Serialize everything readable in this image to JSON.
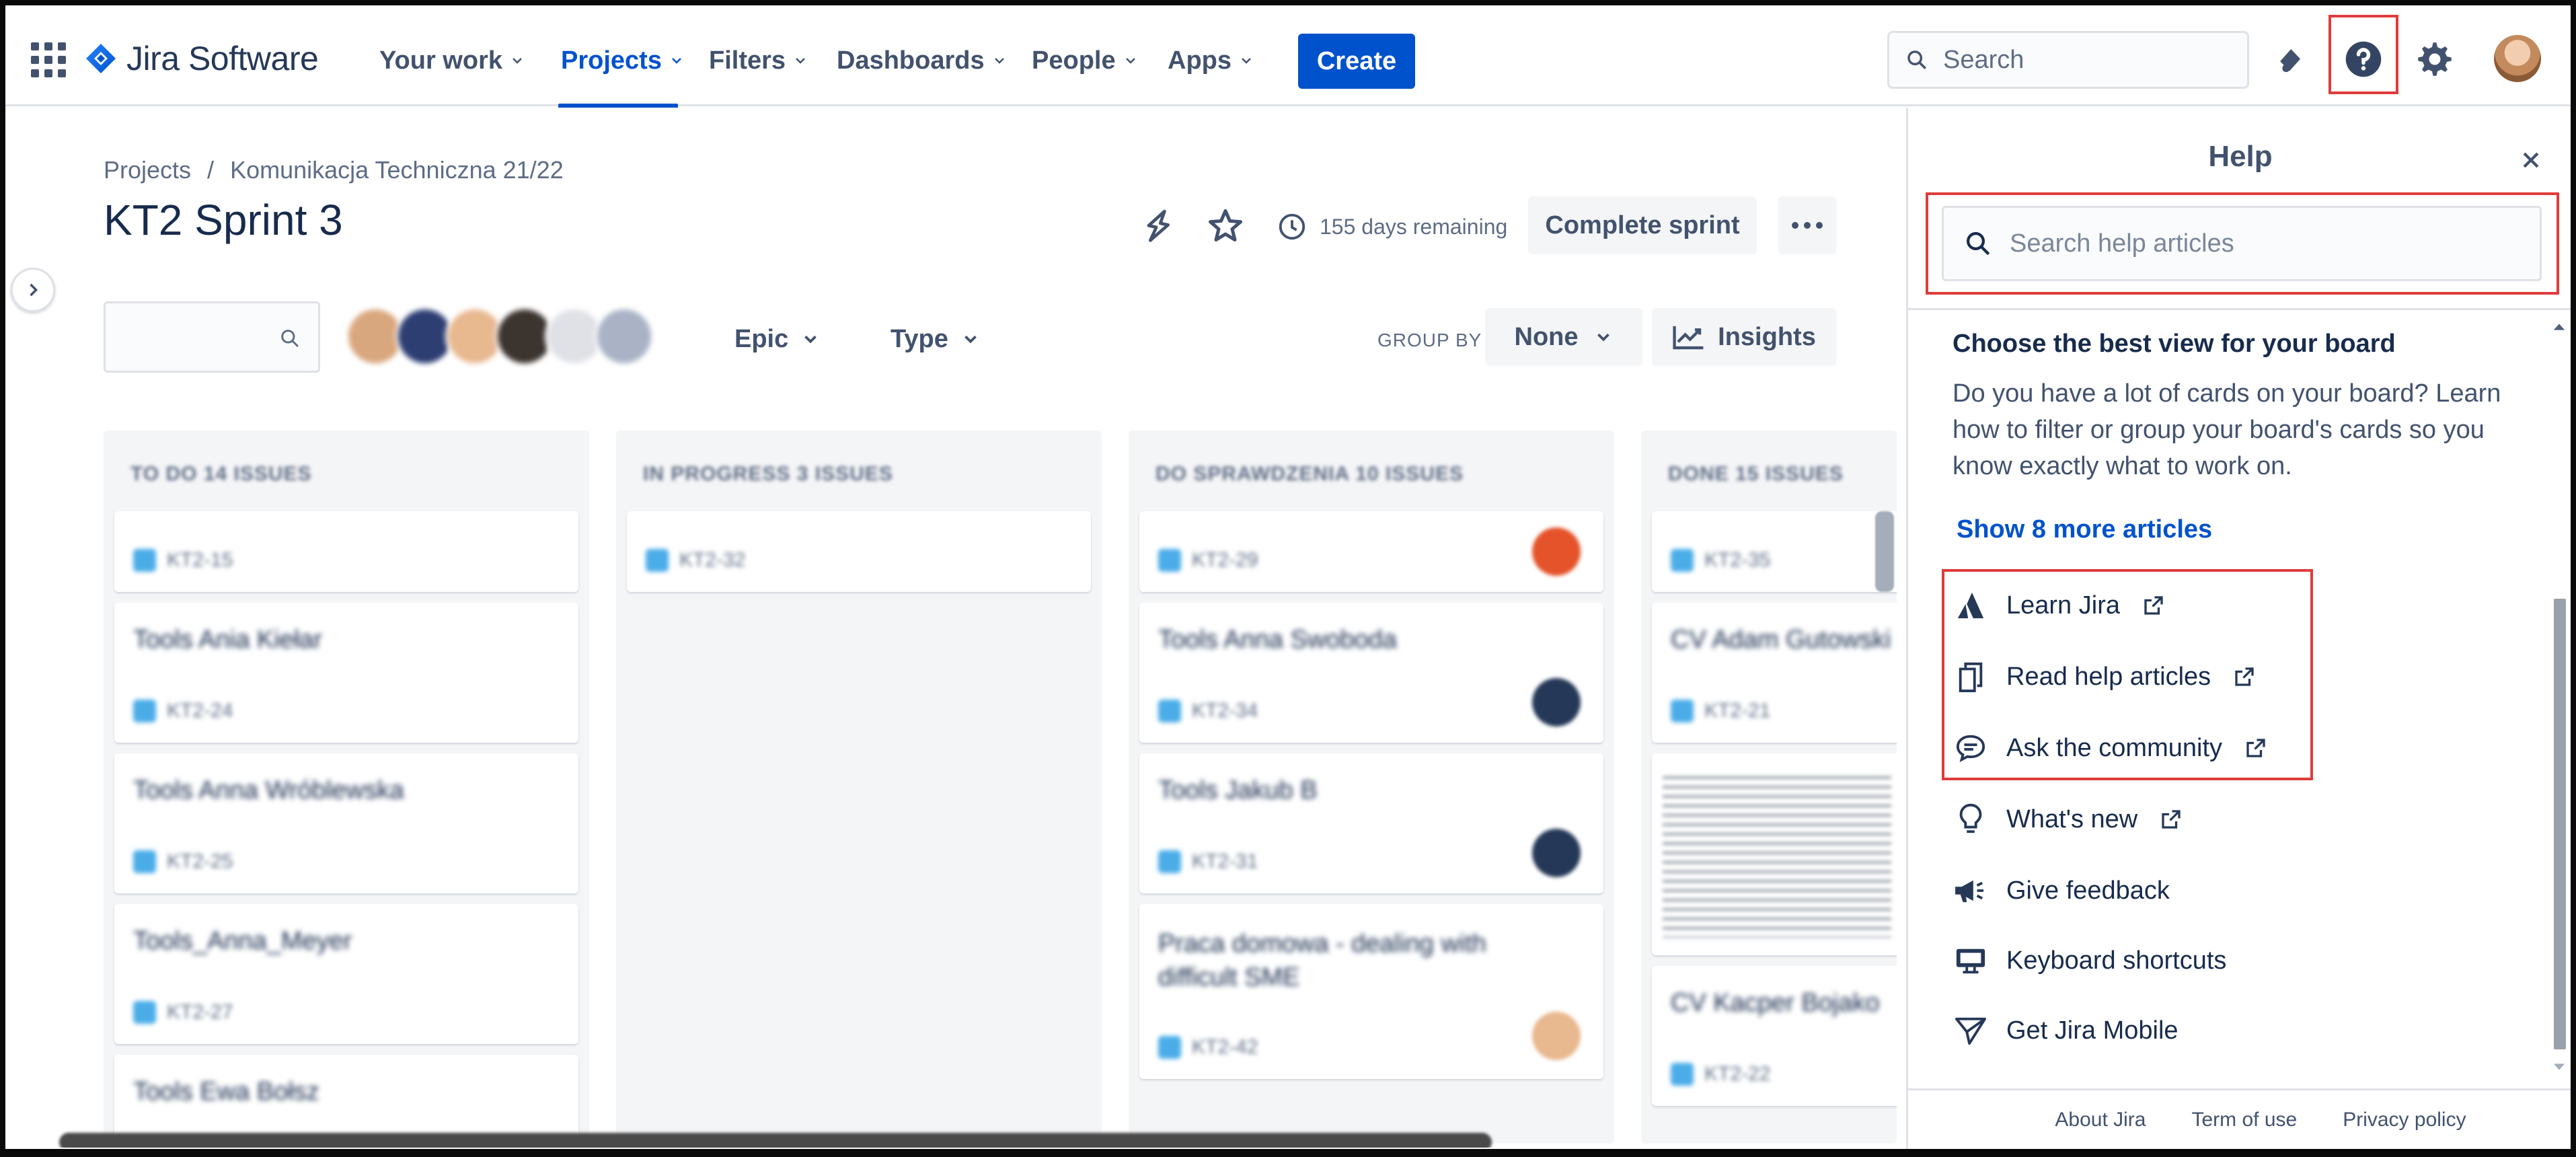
{
  "brand": {
    "name": "Jira Software",
    "accent": "#0052cc",
    "highlight": "#e03c3c"
  },
  "topnav": {
    "items": [
      {
        "label": "Your work"
      },
      {
        "label": "Projects"
      },
      {
        "label": "Filters"
      },
      {
        "label": "Dashboards"
      },
      {
        "label": "People"
      },
      {
        "label": "Apps"
      }
    ],
    "active": "Projects",
    "create_label": "Create",
    "search_placeholder": "Search",
    "icons": [
      "app-switcher-icon",
      "notifications-icon",
      "help-icon",
      "settings-icon",
      "profile-avatar"
    ]
  },
  "board": {
    "breadcrumb": [
      "Projects",
      "/",
      "Komunikacja Techniczna 21/22"
    ],
    "title": "KT2 Sprint 3",
    "days_remaining": "155 days remaining",
    "complete_label": "Complete sprint",
    "filters": {
      "epic": "Epic",
      "type": "Type"
    },
    "groupby_label": "GROUP BY",
    "groupby_value": "None",
    "insights_label": "Insights",
    "columns": [
      {
        "header": "TO DO 14 ISSUES",
        "cards": [
          {
            "title": "",
            "key": "KT2-15"
          },
          {
            "title": "Tools Ania Kiełar",
            "key": "KT2-24"
          },
          {
            "title": "Tools Anna Wróblewska",
            "key": "KT2-25"
          },
          {
            "title": "Tools_Anna_Meyer",
            "key": "KT2-27"
          },
          {
            "title": "Tools Ewa Bołsz",
            "key": ""
          }
        ]
      },
      {
        "header": "IN PROGRESS 3 ISSUES",
        "cards": [
          {
            "title": "",
            "key": "KT2-32"
          }
        ]
      },
      {
        "header": "DO SPRAWDZENIA 10 ISSUES",
        "cards": [
          {
            "title": "",
            "key": "KT2-29"
          },
          {
            "title": "Tools Anna Swoboda",
            "key": "KT2-34"
          },
          {
            "title": "Tools Jakub B",
            "key": "KT2-31"
          },
          {
            "title": "Praca domowa - dealing with difficult SME",
            "key": "KT2-42"
          }
        ]
      },
      {
        "header": "DONE 15 ISSUES",
        "cards": [
          {
            "title": "",
            "key": "KT2-35"
          },
          {
            "title": "CV Adam Gutowski",
            "key": "KT2-21"
          },
          {
            "title": "",
            "key": ""
          },
          {
            "title": "CV Kacper Bojako",
            "key": "KT2-22"
          }
        ]
      }
    ]
  },
  "help": {
    "title": "Help",
    "search_placeholder": "Search help articles",
    "article_title": "Choose the best view for your board",
    "article_body": "Do you have a lot of cards on your board? Learn how to filter or group your board's cards so you know exactly what to work on.",
    "show_more": "Show 8 more articles",
    "links": [
      {
        "label": "Learn Jira",
        "icon": "atlassian-icon",
        "external": true
      },
      {
        "label": "Read help articles",
        "icon": "documents-icon",
        "external": true
      },
      {
        "label": "Ask the community",
        "icon": "community-icon",
        "external": true
      },
      {
        "label": "What's new",
        "icon": "lightbulb-icon",
        "external": true
      },
      {
        "label": "Give feedback",
        "icon": "megaphone-icon",
        "external": false
      },
      {
        "label": "Keyboard shortcuts",
        "icon": "keyboard-icon",
        "external": false
      },
      {
        "label": "Get Jira Mobile",
        "icon": "send-icon",
        "external": false
      }
    ],
    "footer": [
      "About Jira",
      "Term of use",
      "Privacy policy"
    ]
  }
}
